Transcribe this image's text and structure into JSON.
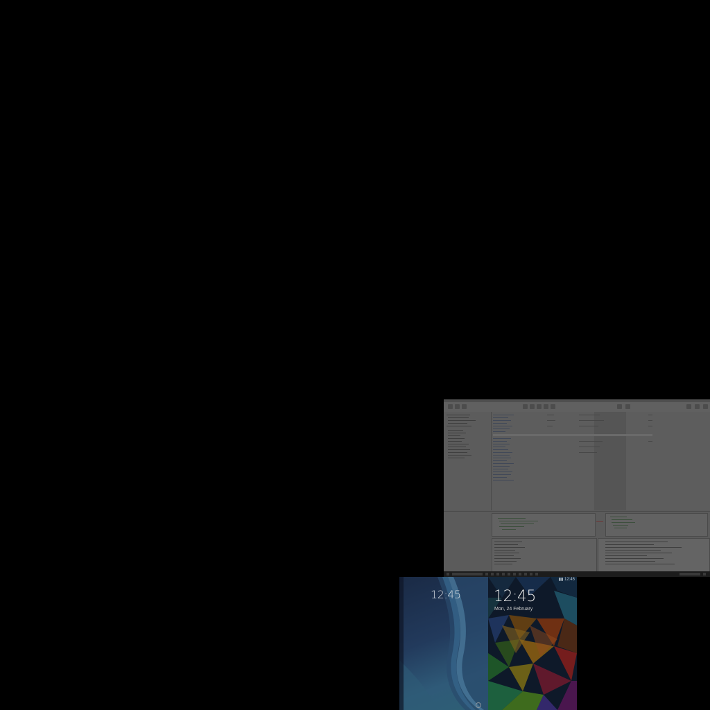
{
  "desktop_window": {
    "title": "",
    "accent_color": "#5a5a5a"
  },
  "phone_left": {
    "time": "12:45",
    "ampm": "",
    "date": "",
    "status_time": "",
    "lock_icon": "lock-circle-icon"
  },
  "phone_right": {
    "time": "12:45",
    "date": "Mon, 24 February",
    "status_time": "12:45"
  },
  "colors": {
    "background": "#000000",
    "phone_left_wallpaper": "#223a5c",
    "phone_right_wallpaper": "#13233a"
  }
}
